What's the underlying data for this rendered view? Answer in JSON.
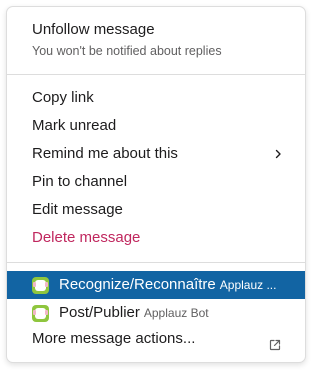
{
  "unfollow": {
    "title": "Unfollow message",
    "subtitle": "You won't be notified about replies"
  },
  "actions": [
    {
      "label": "Copy link"
    },
    {
      "label": "Mark unread"
    },
    {
      "label": "Remind me about this",
      "icon": "chevron-right-icon"
    },
    {
      "label": "Pin to channel"
    },
    {
      "label": "Edit message"
    },
    {
      "label": "Delete message",
      "color": "#c0275e"
    }
  ],
  "apps": [
    {
      "label": "Recognize/Reconnaître",
      "bot": "Applauz ...",
      "selected": true,
      "icon": "applauz-bot-icon"
    },
    {
      "label": "Post/Publier",
      "bot": "Applauz Bot",
      "selected": false,
      "icon": "applauz-bot-icon"
    }
  ],
  "more_actions": {
    "label": "More message actions...",
    "icon": "external-link-icon"
  },
  "colors": {
    "accent_selected": "#1264a3",
    "danger": "#c0275e",
    "text": "#1d1c1d",
    "muted": "#616061"
  }
}
